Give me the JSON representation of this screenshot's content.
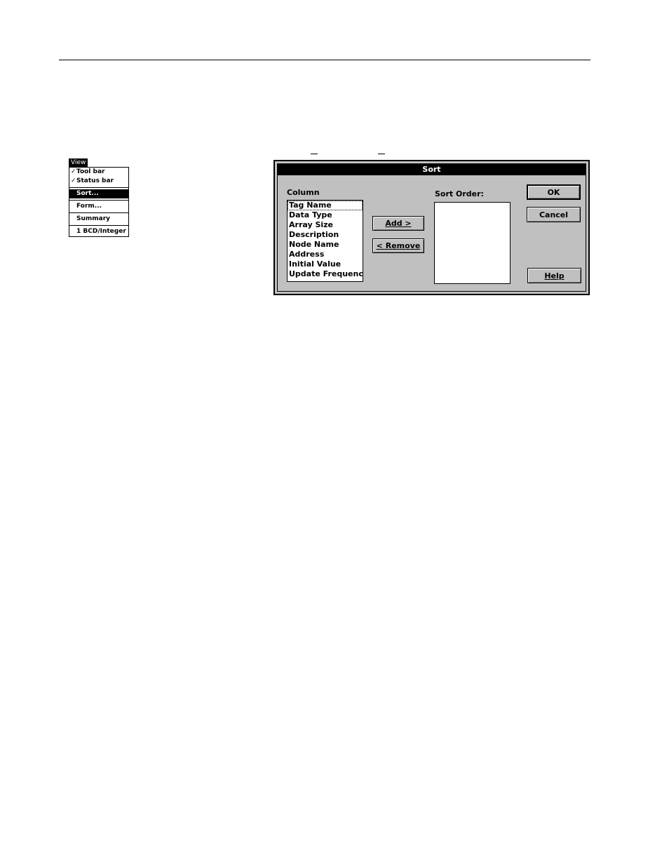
{
  "menu": {
    "title": "View",
    "items": [
      {
        "label": "Tool bar",
        "checked": true
      },
      {
        "label": "Status bar",
        "checked": true
      },
      {
        "label": "Sort...",
        "selected": true
      },
      {
        "label": "Form..."
      },
      {
        "label": "Summary"
      },
      {
        "label": "1 BCD/Integer"
      }
    ]
  },
  "dialog": {
    "title": "Sort",
    "column_label": "Column",
    "sort_order_label": "Sort Order:",
    "columns": [
      "Tag Name",
      "Data Type",
      "Array Size",
      "Description",
      "Node Name",
      "Address",
      "Initial Value",
      "Update Frequency"
    ],
    "buttons": {
      "ok": "OK",
      "cancel": "Cancel",
      "add": "Add >",
      "remove": "< Remove",
      "help": "Help"
    }
  }
}
